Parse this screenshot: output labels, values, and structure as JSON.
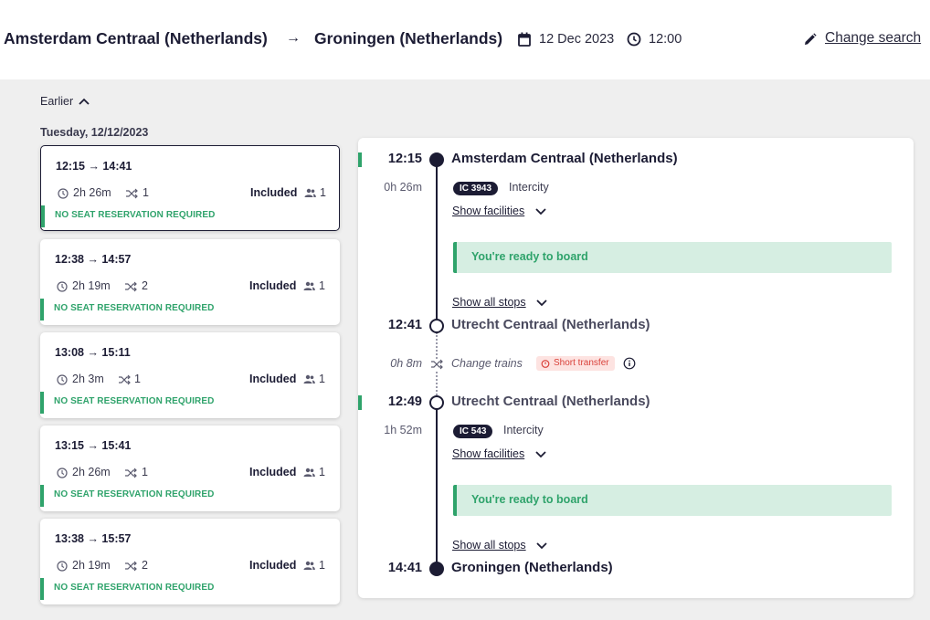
{
  "header": {
    "from": "Amsterdam Centraal (Netherlands)",
    "arrow": "→",
    "to": "Groningen (Netherlands)",
    "date": "12 Dec 2023",
    "time": "12:00",
    "change_search": "Change search"
  },
  "list": {
    "earlier": "Earlier",
    "day": "Tuesday, 12/12/2023",
    "cards": [
      {
        "times": "12:15 → 14:41",
        "duration": "2h 26m",
        "changes": "1",
        "included": "Included",
        "passengers": "1",
        "seat": "NO SEAT RESERVATION REQUIRED"
      },
      {
        "times": "12:38 → 14:57",
        "duration": "2h 19m",
        "changes": "2",
        "included": "Included",
        "passengers": "1",
        "seat": "NO SEAT RESERVATION REQUIRED"
      },
      {
        "times": "13:08 → 15:11",
        "duration": "2h 3m",
        "changes": "1",
        "included": "Included",
        "passengers": "1",
        "seat": "NO SEAT RESERVATION REQUIRED"
      },
      {
        "times": "13:15 → 15:41",
        "duration": "2h 26m",
        "changes": "1",
        "included": "Included",
        "passengers": "1",
        "seat": "NO SEAT RESERVATION REQUIRED"
      },
      {
        "times": "13:38 → 15:57",
        "duration": "2h 19m",
        "changes": "2",
        "included": "Included",
        "passengers": "1",
        "seat": "NO SEAT RESERVATION REQUIRED"
      }
    ]
  },
  "detail": {
    "stop1": {
      "time": "12:15",
      "station": "Amsterdam Centraal (Netherlands)"
    },
    "leg1": {
      "duration": "0h 26m",
      "train": "IC 3943",
      "type": "Intercity",
      "facilities": "Show facilities",
      "ready": "You're ready to board",
      "all_stops": "Show all stops"
    },
    "stop2": {
      "time": "12:41",
      "station": "Utrecht Centraal (Netherlands)"
    },
    "transfer": {
      "duration": "0h 8m",
      "text": "Change trains",
      "badge": "Short transfer"
    },
    "stop3": {
      "time": "12:49",
      "station": "Utrecht Centraal (Netherlands)"
    },
    "leg2": {
      "duration": "1h 52m",
      "train": "IC 543",
      "type": "Intercity",
      "facilities": "Show facilities",
      "ready": "You're ready to board",
      "all_stops": "Show all stops"
    },
    "stop4": {
      "time": "14:41",
      "station": "Groningen (Netherlands)"
    }
  },
  "colors": {
    "navy": "#1c1c34",
    "green": "#2fa36b",
    "red": "#d9413a",
    "background": "#efefef"
  },
  "icons": [
    "calendar-icon",
    "clock-icon",
    "pencil-icon",
    "chevron-up-icon",
    "shuffle-icon",
    "people-icon",
    "chevron-down-icon",
    "timer-icon",
    "info-icon"
  ]
}
